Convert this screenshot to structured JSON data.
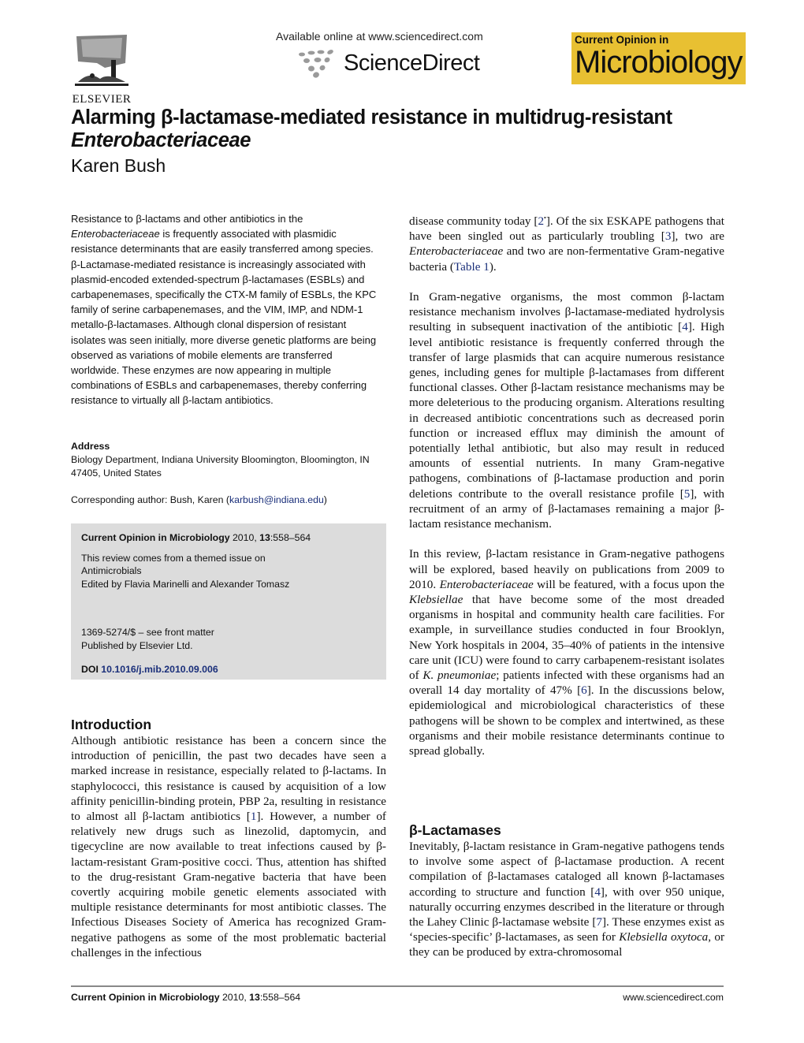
{
  "header": {
    "publisher_logo": {
      "icon": "elsevier-tree-logo",
      "label": "ELSEVIER"
    },
    "available_online": "Available online at www.sciencedirect.com",
    "platform_logo": {
      "icon": "sciencedirect-dots-logo",
      "label": "ScienceDirect"
    },
    "journal_badge": {
      "line1": "Current Opinion in",
      "line2": "Microbiology",
      "color": "#e8c032"
    }
  },
  "article": {
    "title_line1": "Alarming β-lactamase-mediated resistance in multidrug-resistant",
    "title_line2": "Enterobacteriaceae",
    "author": "Karen Bush"
  },
  "abstract": {
    "p1_a": "Resistance to β-lactams and other antibiotics in the",
    "p1_ital": "Enterobacteriaceae",
    "p1_b": " is frequently associated with plasmidic resistance determinants that are easily transferred among species. β-Lactamase-mediated resistance is increasingly associated with plasmid-encoded extended-spectrum β-lactamases (ESBLs) and carbapenemases, specifically the CTX-M family of ESBLs, the KPC family of serine carbapenemases, and the VIM, IMP, and NDM-1 metallo-β-lactamases. Although clonal dispersion of resistant isolates was seen initially, more diverse genetic platforms are being observed as variations of mobile elements are transferred worldwide. These enzymes are now appearing in multiple combinations of ESBLs and carbapenemases, thereby conferring resistance to virtually all β-lactam antibiotics."
  },
  "address": {
    "label": "Address",
    "text": "Biology Department, Indiana University Bloomington, Bloomington, IN 47405, United States",
    "corresponding_prefix": "Corresponding author: Bush, Karen (",
    "email": "karbush@indiana.edu",
    "corresponding_suffix": ")"
  },
  "info_box": {
    "journal": "Current Opinion in Microbiology",
    "year": " 2010, ",
    "volume": "13",
    "pages": ":558–564",
    "themed_line1": "This review comes from a themed issue on",
    "themed_line2": "Antimicrobials",
    "edited_by": "Edited by Flavia Marinelli and Alexander Tomasz",
    "issn": "1369-5274/$ – see front matter",
    "publisher": "Published by Elsevier Ltd.",
    "doi_label": "DOI",
    "doi": "10.1016/j.mib.2010.09.006",
    "background": "#dcdcdc"
  },
  "introduction": {
    "heading": "Introduction",
    "t1": "Although antibiotic resistance has been a concern since the introduction of penicillin, the past two decades have seen a marked increase in resistance, especially related to β-lactams. In staphylococci, this resistance is caused by acquisition of a low affinity penicillin-binding protein, PBP 2a, resulting in resistance to almost all β-lactam antibiotics [",
    "ref1": "1",
    "t2": "]. However, a number of relatively new drugs such as linezolid, daptomycin, and tigecycline are now available to treat infections caused by β-lactam-resistant Gram-positive cocci. Thus, attention has shifted to the drug-resistant Gram-negative bacteria that have been covertly acquiring mobile genetic elements associ­ated with multiple resistance determinants for most anti­biotic classes. The Infectious Diseases Society of America has recognized Gram-negative pathogens as some of the most problematic bacterial challenges in the infectious"
  },
  "right_column": {
    "p1_a": "disease community today [",
    "p1_ref2": "2",
    "p1_ref2_mark": "•",
    "p1_b": "]. Of the six ESKAPE patho­gens that have been singled out as particularly troubling [",
    "p1_ref3": "3",
    "p1_c": "], two are ",
    "p1_ital": "Enterobacteriaceae",
    "p1_d": " and two are non-fermenta­tive Gram-negative bacteria (",
    "p1_table": "Table 1",
    "p1_e": ").",
    "p2_a": "In Gram-negative organisms, the most common β-lactam resistance mechanism involves β-lactamase-mediated hydrolysis resulting in subsequent inactivation of the antibiotic [",
    "p2_ref4": "4",
    "p2_b": "]. High level antibiotic resistance is fre­quently conferred through the transfer of large plasmids that can acquire numerous resistance genes, including genes for multiple β-lactamases from different functional classes. Other β-lactam resistance mechanisms may be more deleterious to the producing organism. Alterations resulting in decreased antibiotic concentrations such as decreased porin function or increased efflux may diminish the amount of potentially lethal antibiotic, but also may result in reduced amounts of essential nutrients. In many Gram-negative pathogens, combinations of β-lactamase production and porin deletions contribute to the overall resistance profile [",
    "p2_ref5": "5",
    "p2_c": "], with recruitment of an army of β-lactamases remaining a major β-lactam resistance mech­anism.",
    "p3_a": "In this review, β-lactam resistance in Gram-negative pathogens will be explored, based heavily on publications from 2009 to 2010. ",
    "p3_ital1": "Enterobacteriaceae",
    "p3_b": " will be featured, with a focus upon the ",
    "p3_ital2": "Klebsiellae",
    "p3_c": " that have become some of the most dreaded organisms in hospital and community health care facilities. For example, in surveillance studies conducted in four Brooklyn, New York hospitals in 2004, 35–40% of patients in the intensive care unit (ICU) were found to carry carbapenem-resistant isolates of ",
    "p3_ital3": "K. pneu­moniae",
    "p3_d": "; patients infected with these organisms had an overall 14 day mortality of 47% [",
    "p3_ref6": "6",
    "p3_e": "]. In the discussions below, epidemiological and microbiological character­istics of these pathogens will be shown to be complex and intertwined, as these organisms and their mobile resistance determinants continue to spread globally."
  },
  "beta_lactamases": {
    "heading": "β-Lactamases",
    "t1": "Inevitably, β-lactam resistance in Gram-negative patho­gens tends to involve some aspect of β-lactamase pro­duction. A recent compilation of β-lactamases cataloged all known β-lactamases according to structure and func­tion [",
    "ref4": "4",
    "t2": "], with over 950 unique, naturally occurring enzymes described in the literature or through the Lahey Clinic β-lactamase website [",
    "ref7": "7",
    "t3": "]. These enzymes exist as ‘species-specific’ β-lactamases, as seen for ",
    "ital1": "Klebsiella oxy­toca",
    "t4": ", or they can be produced by extra-chromosomal"
  },
  "footer": {
    "journal": "Current Opinion in Microbiology",
    "year": " 2010, ",
    "volume": "13",
    "pages": ":558–564",
    "website": "www.sciencedirect.com"
  },
  "link_color": "#1a2f7a"
}
